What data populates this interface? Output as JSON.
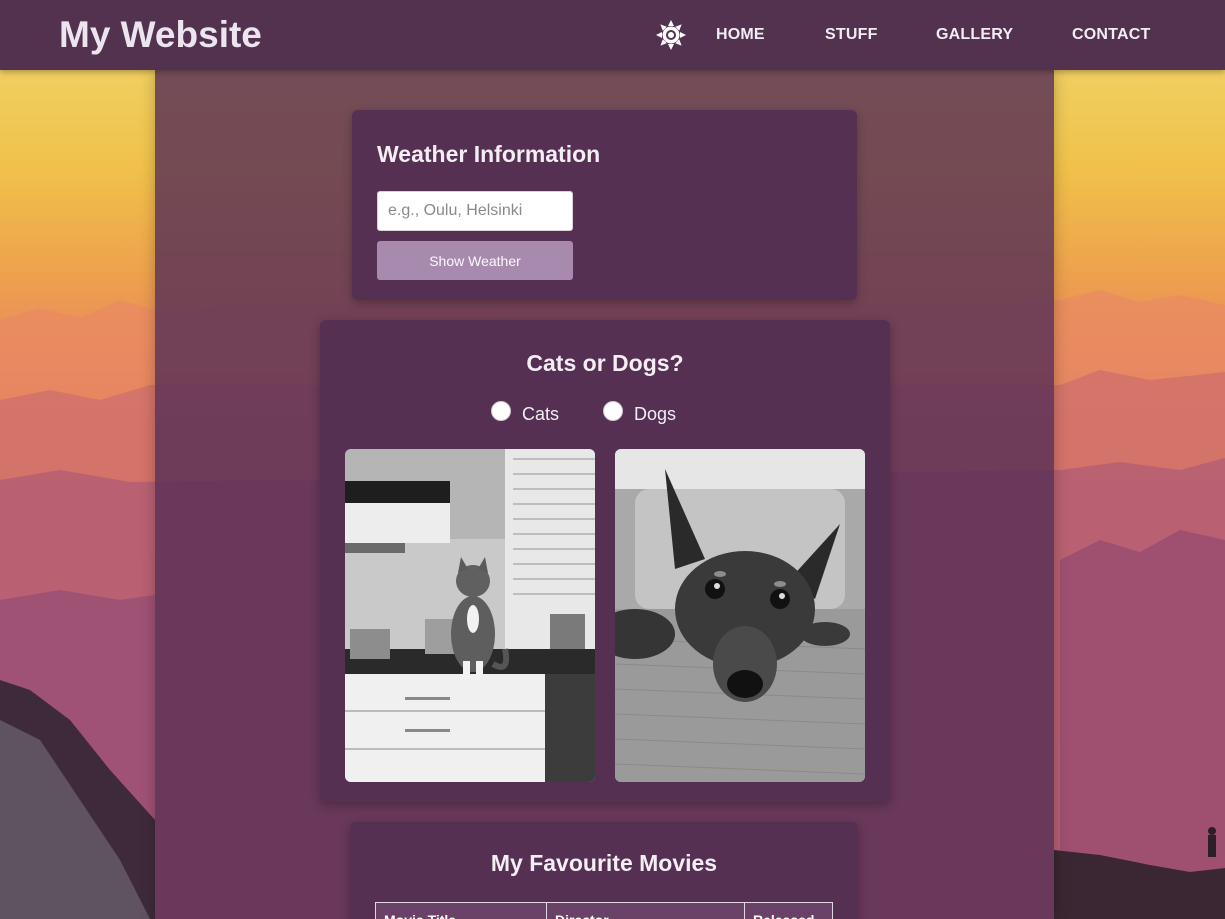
{
  "header": {
    "site_title": "My Website",
    "theme_toggle_icon": "sun-icon",
    "nav": [
      {
        "label": "HOME"
      },
      {
        "label": "STUFF"
      },
      {
        "label": "GALLERY"
      },
      {
        "label": "CONTACT"
      }
    ]
  },
  "weather": {
    "title": "Weather Information",
    "input_placeholder": "e.g., Oulu, Helsinki",
    "input_value": "",
    "button_label": "Show Weather"
  },
  "pets": {
    "title": "Cats or Dogs?",
    "options": [
      {
        "label": "Cats",
        "checked": false
      },
      {
        "label": "Dogs",
        "checked": false
      }
    ],
    "photos": [
      "cat-photo",
      "dog-photo"
    ]
  },
  "movies": {
    "title": "My Favourite Movies",
    "columns": [
      "Movie Title",
      "Director",
      "Released"
    ]
  },
  "colors": {
    "header_bg": "#533250",
    "card_bg": "#553052",
    "button_bg": "#a88aae",
    "text_light": "#f3edf4"
  }
}
